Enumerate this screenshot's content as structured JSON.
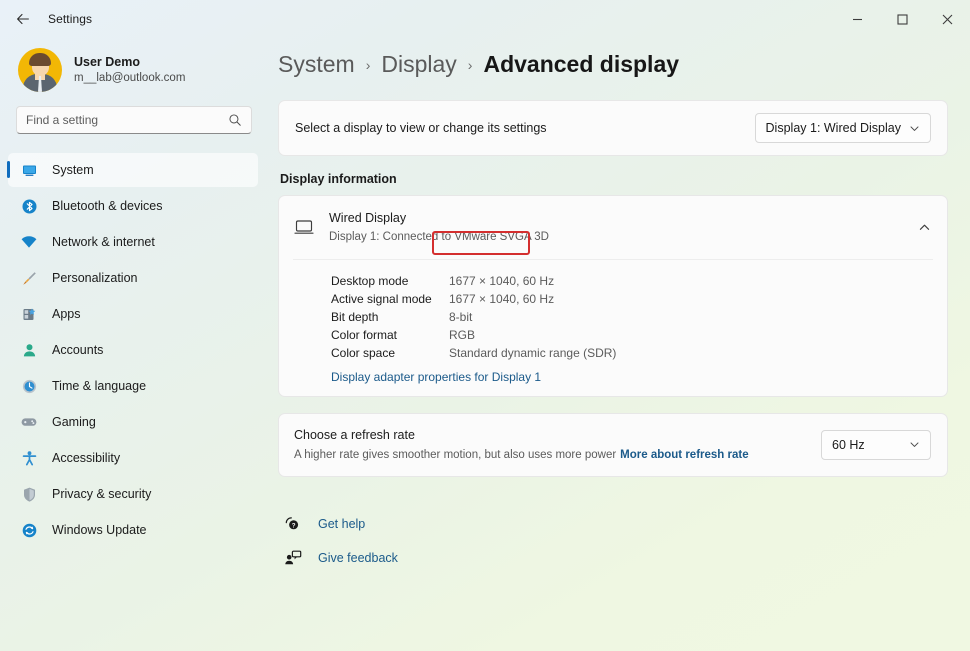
{
  "titlebar": {
    "back_icon": "back-arrow-icon",
    "app_title": "Settings",
    "minimize": "minimize-icon",
    "maximize": "maximize-icon",
    "close": "close-icon"
  },
  "sidebar": {
    "profile": {
      "name": "User Demo",
      "email": "m__lab@outlook.com"
    },
    "search": {
      "placeholder": "Find a setting",
      "value": ""
    },
    "items": [
      {
        "label": "System",
        "icon": "monitor-icon",
        "active": true
      },
      {
        "label": "Bluetooth & devices",
        "icon": "bluetooth-icon",
        "active": false
      },
      {
        "label": "Network & internet",
        "icon": "wifi-icon",
        "active": false
      },
      {
        "label": "Personalization",
        "icon": "paintbrush-icon",
        "active": false
      },
      {
        "label": "Apps",
        "icon": "apps-icon",
        "active": false
      },
      {
        "label": "Accounts",
        "icon": "person-icon",
        "active": false
      },
      {
        "label": "Time & language",
        "icon": "clock-globe-icon",
        "active": false
      },
      {
        "label": "Gaming",
        "icon": "gamepad-icon",
        "active": false
      },
      {
        "label": "Accessibility",
        "icon": "accessibility-icon",
        "active": false
      },
      {
        "label": "Privacy & security",
        "icon": "shield-icon",
        "active": false
      },
      {
        "label": "Windows Update",
        "icon": "update-icon",
        "active": false
      }
    ]
  },
  "breadcrumb": {
    "crumb1": "System",
    "sep": "›",
    "crumb2": "Display",
    "crumb3": "Advanced display"
  },
  "display_select": {
    "label": "Select a display to view or change its settings",
    "dropdown_value": "Display 1: Wired Display",
    "chevron": "chevron-down-icon"
  },
  "display_information": {
    "section_title": "Display information",
    "device": {
      "icon": "monitor-outline-icon",
      "title": "Wired Display",
      "subtitle_prefix": "Display 1: Connected to",
      "adapter": "VMware SVGA 3D",
      "expand_icon": "chevron-up-icon"
    },
    "details": [
      {
        "label": "Desktop mode",
        "value": "1677 × 1040, 60 Hz"
      },
      {
        "label": "Active signal mode",
        "value": "1677 × 1040, 60 Hz"
      },
      {
        "label": "Bit depth",
        "value": "8-bit"
      },
      {
        "label": "Color format",
        "value": "RGB"
      },
      {
        "label": "Color space",
        "value": "Standard dynamic range (SDR)"
      }
    ],
    "adapter_link": "Display adapter properties for Display 1"
  },
  "refresh_rate": {
    "title": "Choose a refresh rate",
    "subtitle": "A higher rate gives smoother motion, but also uses more power",
    "link": "More about refresh rate",
    "dropdown_value": "60 Hz",
    "chevron": "chevron-down-icon"
  },
  "footer": {
    "links": [
      {
        "label": "Get help",
        "icon": "help-icon"
      },
      {
        "label": "Give feedback",
        "icon": "feedback-icon"
      }
    ]
  },
  "annotation": {
    "color": "#d42f2f",
    "target": "VMware SVGA 3D"
  }
}
